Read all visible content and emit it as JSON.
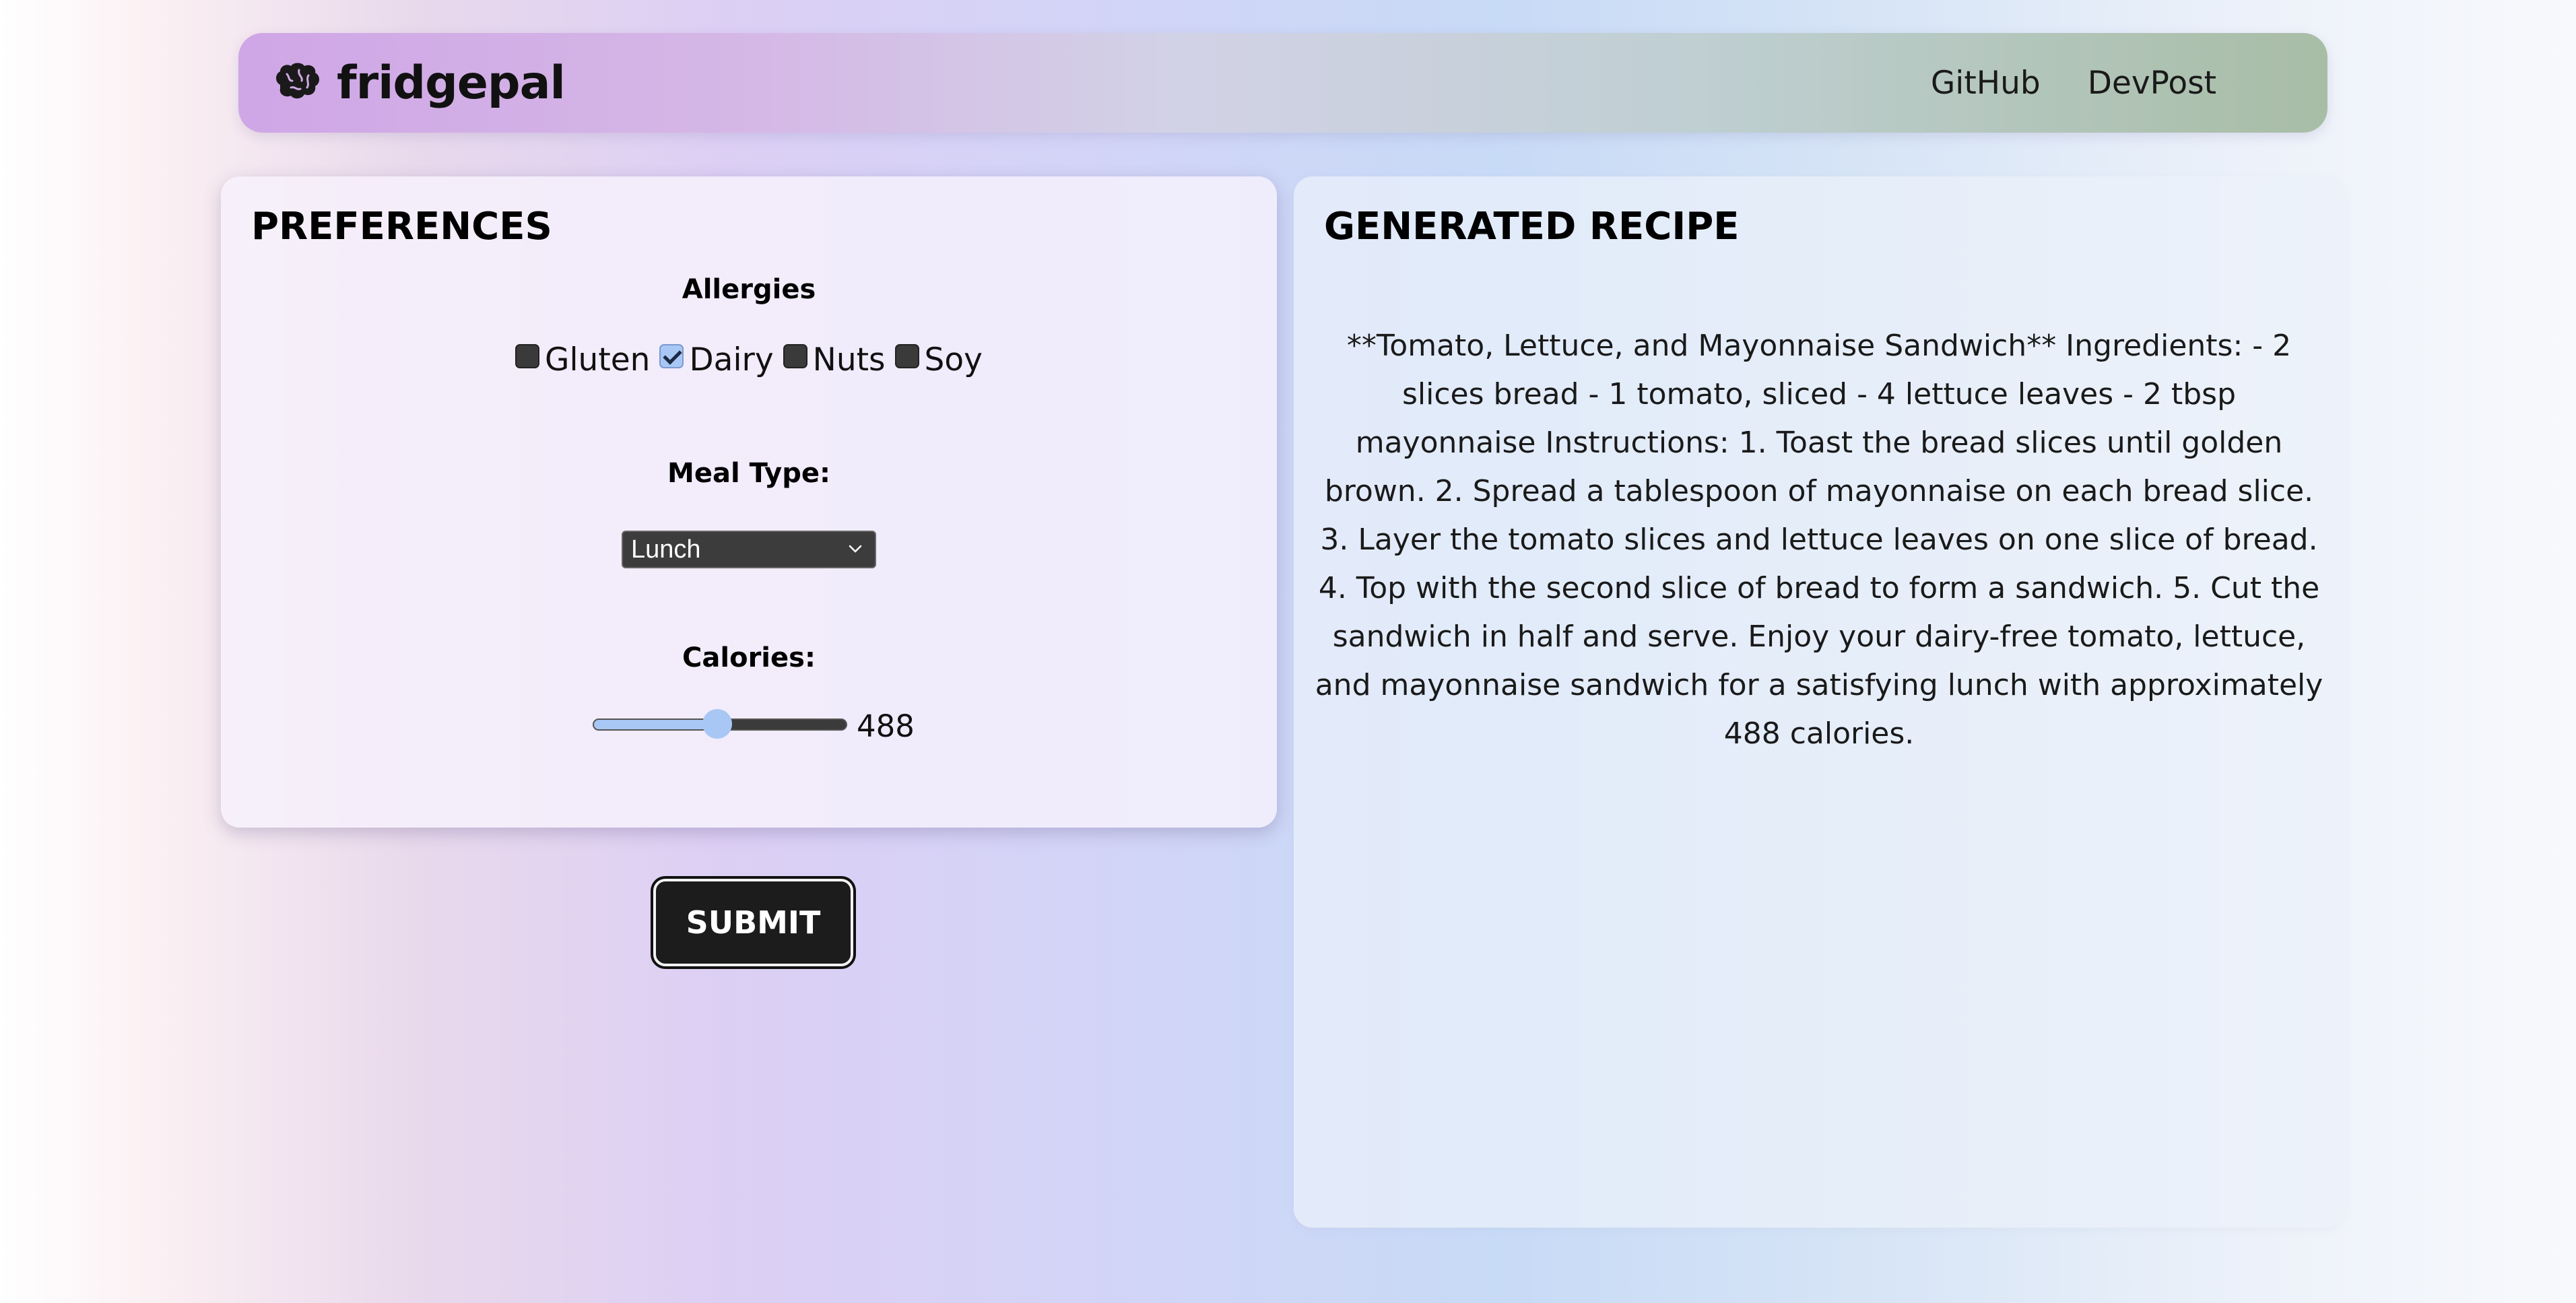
{
  "navbar": {
    "brand_name": "fridgepal",
    "brand_icon": "brain-icon",
    "links": [
      "GitHub",
      "DevPost"
    ]
  },
  "preferences": {
    "title": "PREFERENCES",
    "allergies_label": "Allergies",
    "allergies": [
      {
        "label": "Gluten",
        "checked": false
      },
      {
        "label": "Dairy",
        "checked": true
      },
      {
        "label": "Nuts",
        "checked": false
      },
      {
        "label": "Soy",
        "checked": false
      }
    ],
    "meal_type_label": "Meal Type:",
    "meal_type_value": "Lunch",
    "calories_label": "Calories:",
    "calories_value": "488",
    "calories_slider_fraction": 0.49
  },
  "submit_label": "SUBMIT",
  "recipe": {
    "title": "GENERATED RECIPE",
    "text": "**Tomato, Lettuce, and Mayonnaise Sandwich** Ingredients: - 2 slices bread - 1 tomato, sliced - 4 lettuce leaves - 2 tbsp mayonnaise Instructions: 1. Toast the bread slices until golden brown. 2. Spread a tablespoon of mayonnaise on each bread slice. 3. Layer the tomato slices and lettuce leaves on one slice of bread. 4. Top with the second slice of bread to form a sandwich. 5. Cut the sandwich in half and serve. Enjoy your dairy-free tomato, lettuce, and mayonnaise sandwich for a satisfying lunch with approximately 488 calories."
  },
  "colors": {
    "accent": "#a9c7f5",
    "button_bg": "#1c1c1c",
    "checkbox_unchecked": "#3a3a3a"
  }
}
